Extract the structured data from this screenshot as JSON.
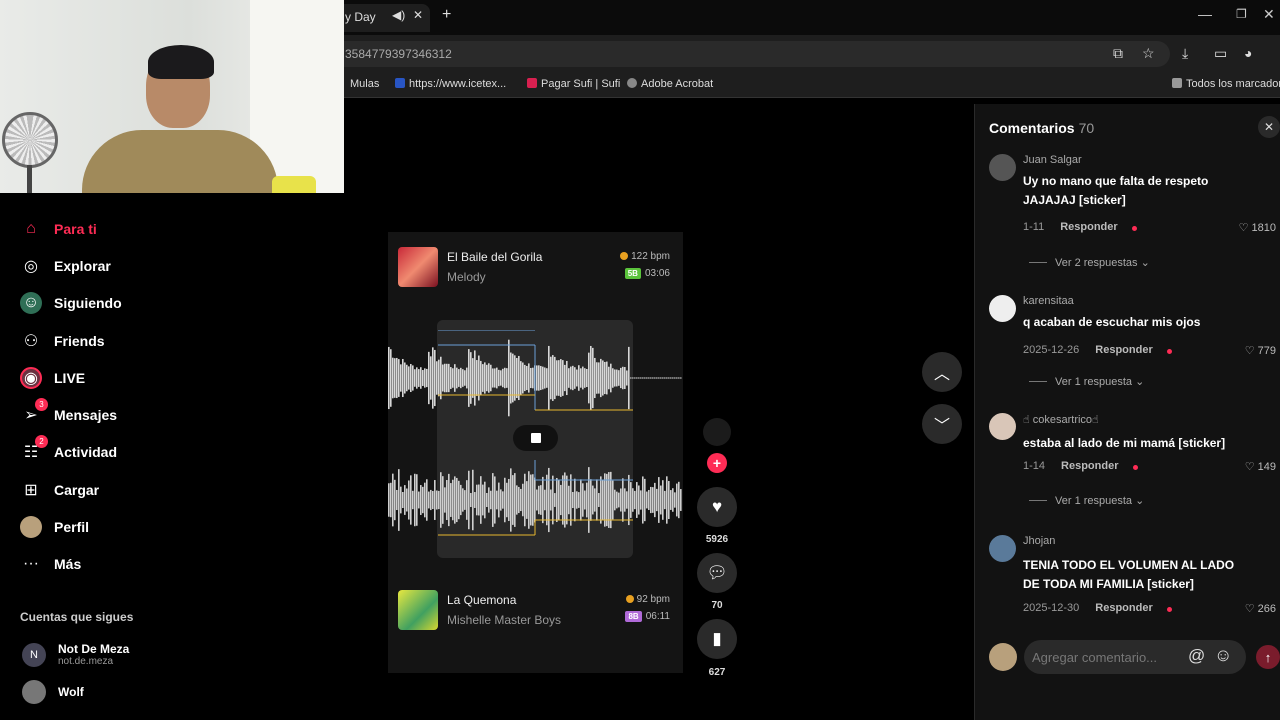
{
  "browser": {
    "tab_title": "y Day",
    "url": "3584779397346312",
    "bookmarks": [
      {
        "label": "Mulas",
        "color": "#6a4bd4"
      },
      {
        "label": "https://www.icetex...",
        "color": "#2855c4"
      },
      {
        "label": "Pagar Sufi | Sufi",
        "color": "#d82050"
      },
      {
        "label": "Adobe Acrobat",
        "color": "#888888"
      }
    ],
    "all_bookmarks": "Todos los marcadores"
  },
  "nav": {
    "items": [
      {
        "label": "Para ti",
        "icon": "home-icon",
        "glyph": "⌂"
      },
      {
        "label": "Explorar",
        "icon": "compass-icon",
        "glyph": "◎"
      },
      {
        "label": "Siguiendo",
        "icon": "following-avatar-icon",
        "glyph": "☺"
      },
      {
        "label": "Friends",
        "icon": "friends-icon",
        "glyph": "⚇"
      },
      {
        "label": "LIVE",
        "icon": "live-icon",
        "glyph": "◉"
      },
      {
        "label": "Mensajes",
        "icon": "send-icon",
        "glyph": "➢",
        "badge": "3"
      },
      {
        "label": "Actividad",
        "icon": "activity-icon",
        "glyph": "☷",
        "badge": "2"
      },
      {
        "label": "Cargar",
        "icon": "upload-icon",
        "glyph": "⊞"
      },
      {
        "label": "Perfil",
        "icon": "profile-avatar-icon",
        "glyph": "●"
      },
      {
        "label": "Más",
        "icon": "more-icon",
        "glyph": "···"
      }
    ],
    "following_title": "Cuentas que sigues",
    "accounts": [
      {
        "name": "Not De Meza",
        "handle": "not.de.meza",
        "initial": "N"
      },
      {
        "name": "Wolf",
        "handle": "",
        "initial": ""
      }
    ]
  },
  "video": {
    "song_top": {
      "title": "El Baile del Gorila",
      "artist": "Melody",
      "bpm": "122 bpm",
      "key": "5B",
      "key_color": "#5bc43c",
      "duration": "03:06"
    },
    "song_bottom": {
      "title": "La Quemona",
      "artist": "Mishelle Master Boys",
      "bpm": "92 bpm",
      "key": "8B",
      "key_color": "#b06ad8",
      "duration": "06:11"
    },
    "likes": "5926",
    "comments": "70",
    "saves": "627"
  },
  "comments": {
    "title": "Comentarios",
    "count": "70",
    "reply_label": "Responder",
    "input_placeholder": "Agregar comentario...",
    "items": [
      {
        "user": "Juan Salgar",
        "text": "Uy no mano que falta de respeto JAJAJAJ [sticker]",
        "date": "1-11",
        "likes": "1810",
        "more": "Ver 2 respuestas"
      },
      {
        "user": "karensitaa",
        "text": "q acaban de escuchar mis ojos",
        "date": "2025-12-26",
        "likes": "779",
        "more": "Ver 1 respuesta"
      },
      {
        "user": "☝︎ cokesartrico☝︎",
        "text": "estaba al lado de mi mamá [sticker]",
        "date": "1-14",
        "likes": "149",
        "more": "Ver 1 respuesta"
      },
      {
        "user": "Jhojan",
        "text": "TENIA TODO EL VOLUMEN AL LADO DE TODA MI FAMILIA [sticker]",
        "date": "2025-12-30",
        "likes": "266",
        "more": ""
      }
    ]
  },
  "colors": {
    "accent": "#fe2c55",
    "background": "#000000",
    "panel": "#121212"
  }
}
